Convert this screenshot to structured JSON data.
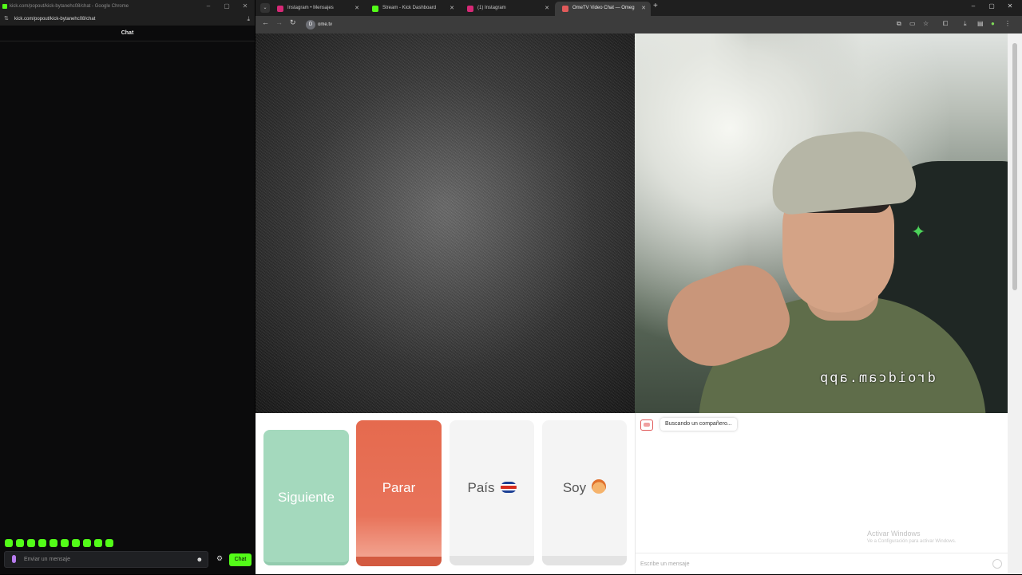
{
  "left_window": {
    "title": "kick.com/popout/kick-bytanehc08/chat - Google Chrome",
    "url": "kick.com/popout/kick-bytanehc08/chat",
    "chat_header": "Chat",
    "input_placeholder": "Enviar un mensaje",
    "send_label": "Chat",
    "emotes": [
      "emote-1",
      "emote-2",
      "emote-3",
      "emote-4",
      "emote-5",
      "emote-6",
      "emote-7",
      "emote-8",
      "emote-9",
      "emote-10"
    ],
    "accent": "#53fc18"
  },
  "browser": {
    "tabs": [
      {
        "label": "Instagram • Mensajes",
        "icon_color": "#d62976",
        "active": false
      },
      {
        "label": "Stream - Kick Dashboard",
        "icon_color": "#53fc18",
        "active": false
      },
      {
        "label": "(1) Instagram",
        "icon_color": "#d62976",
        "active": false
      },
      {
        "label": "OmeTV Video Chat — Omeg",
        "icon_color": "#e05a5a",
        "active": true
      }
    ],
    "url": "ome.tv",
    "site_icon_letter": "D"
  },
  "video": {
    "watermark": "droidcam.app"
  },
  "controls": {
    "next_label": "Siguiente",
    "stop_label": "Parar",
    "country_label": "País",
    "gender_label": "Soy",
    "next_color": "#a4d9bd",
    "stop_color": "#e56a4e"
  },
  "chat": {
    "status": "Buscando un compañero...",
    "input_placeholder": "Escribe un mensaje",
    "activate_title": "Activar Windows",
    "activate_subtitle": "Ve a Configuración para activar Windows."
  }
}
